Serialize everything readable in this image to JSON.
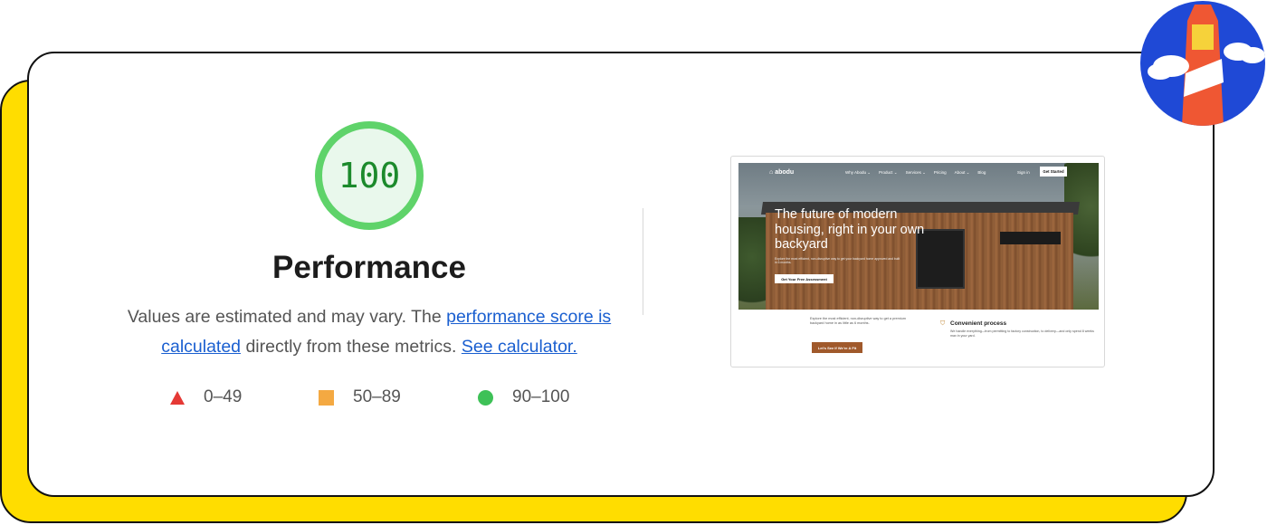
{
  "gauge": {
    "score": "100",
    "rating": "good",
    "color": "#5fd36a"
  },
  "title": "Performance",
  "description": {
    "part1": "Values are estimated and may vary. The ",
    "link1": "performance score is calculated",
    "part2": " directly from these metrics. ",
    "link2": "See calculator."
  },
  "legend": [
    {
      "label": "0–49",
      "shape": "triangle",
      "color": "#e53935"
    },
    {
      "label": "50–89",
      "shape": "square",
      "color": "#f4a942"
    },
    {
      "label": "90–100",
      "shape": "circle",
      "color": "#3ec157"
    }
  ],
  "thumbnail": {
    "logo": "abodu",
    "nav": [
      "Why Abodu ⌄",
      "Product ⌄",
      "Services ⌄",
      "Pricing",
      "About ⌄",
      "Blog"
    ],
    "signin": "Sign in",
    "cta": "Get Started",
    "hero_title": "The future of modern housing, right in your own backyard",
    "hero_sub": "Explore the most efficient, non-disruptive way to get your backyard home approved and built in 6 months.",
    "hero_button": "Get Your Free Assessment",
    "lower_text": "Explore the most efficient, non-disruptive way to get a premium backyard home in as little as 6 months.",
    "lower_button": "Let's See If We're A Fit",
    "feature_title": "Convenient process",
    "feature_text": "We handle everything—from permitting to factory construction, to delivery—and only spend 8 weeks max in your yard."
  },
  "badge": {
    "icon": "lighthouse-icon",
    "colors": {
      "bg": "#1f49d6",
      "tower": "#ef5733",
      "top": "#f6d23a"
    }
  }
}
